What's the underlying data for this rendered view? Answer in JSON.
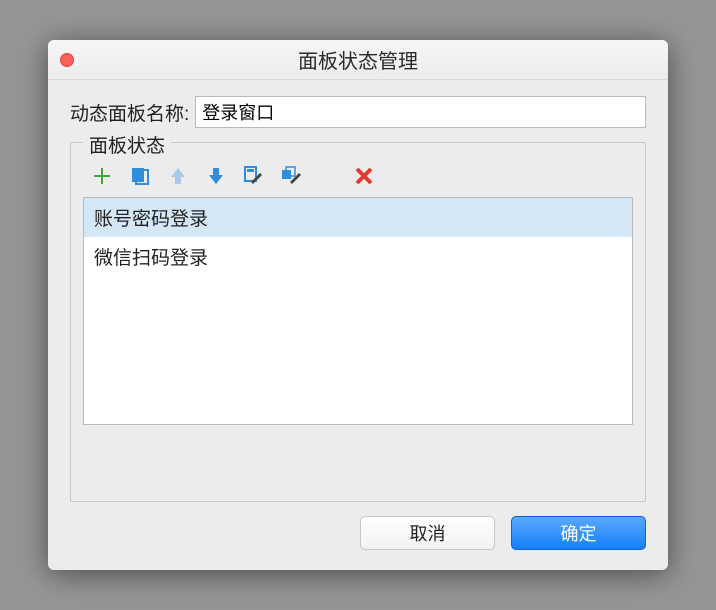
{
  "window": {
    "title": "面板状态管理"
  },
  "panel_name": {
    "label": "动态面板名称:",
    "value": "登录窗口"
  },
  "fieldset": {
    "legend": "面板状态"
  },
  "toolbar": {
    "add": "add",
    "duplicate": "duplicate",
    "moveup": "moveup",
    "movedown": "movedown",
    "edit1": "edit1",
    "edit2": "edit2",
    "delete": "delete"
  },
  "states": {
    "items": [
      {
        "label": "账号密码登录",
        "selected": true
      },
      {
        "label": "微信扫码登录",
        "selected": false
      }
    ]
  },
  "buttons": {
    "cancel": "取消",
    "ok": "确定"
  }
}
